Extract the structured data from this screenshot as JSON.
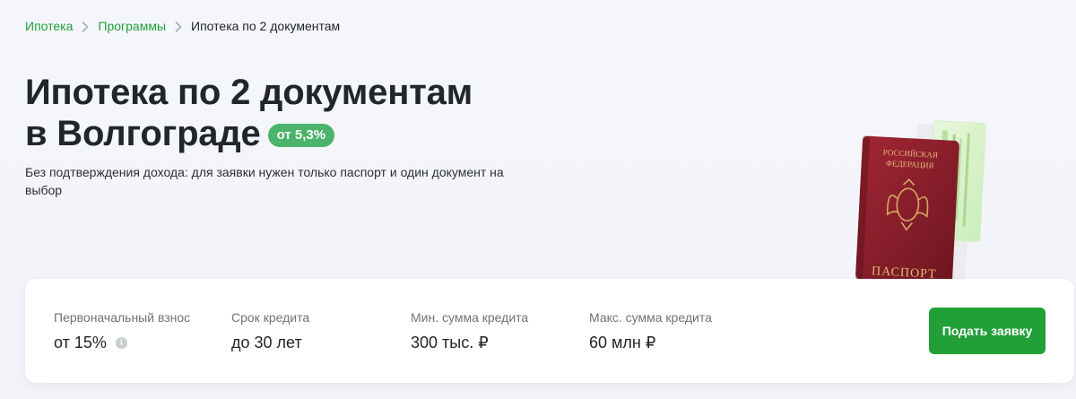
{
  "breadcrumb": {
    "items": [
      {
        "label": "Ипотека"
      },
      {
        "label": "Программы"
      },
      {
        "label": "Ипотека по 2 документам"
      }
    ]
  },
  "hero": {
    "title_line1": "Ипотека по 2 документам",
    "title_line2": "в Волгограде",
    "rate_badge": "от 5,3%",
    "subtitle": "Без подтверждения дохода: для заявки нужен только паспорт и один документ на выбор"
  },
  "illustration": {
    "passport_line1": "РОССИЙСКАЯ",
    "passport_line2": "ФЕДЕРАЦИЯ",
    "passport_word": "ПАСПОРТ",
    "icon": "passport-and-snils-icon"
  },
  "params": [
    {
      "label": "Первоначальный взнос",
      "value": "от 15%",
      "info": "i"
    },
    {
      "label": "Срок кредита",
      "value": "до 30 лет"
    },
    {
      "label": "Мин. сумма кредита",
      "value": "300 тыс. ₽"
    },
    {
      "label": "Макс. сумма кредита",
      "value": "60 млн ₽"
    }
  ],
  "apply_button": {
    "label": "Подать заявку"
  },
  "colors": {
    "brand_green": "#21a038",
    "badge_green": "#4bb46a",
    "passport_red": "#8c1f2a",
    "background": "#f5f6fb"
  }
}
